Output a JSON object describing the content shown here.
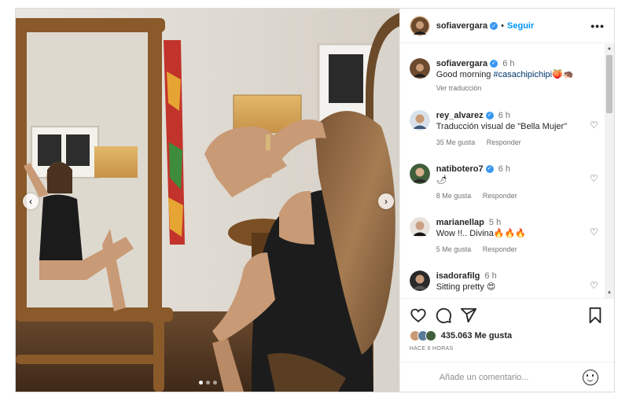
{
  "post": {
    "author": "sofiavergara",
    "separator": "•",
    "follow_label": "Seguir",
    "more_label": "•••"
  },
  "carousel": {
    "prev_label": "‹",
    "next_label": "›",
    "total_slides": 3,
    "active_slide": 1
  },
  "caption": {
    "user": "sofiavergara",
    "time": "6 h",
    "text": "Good morning ",
    "hashtag": "#casachipichipi",
    "emojis": "🍑🦔",
    "translate_label": "Ver traducción"
  },
  "comments": [
    {
      "user": "rey_alvarez",
      "time": "6 h",
      "text": "Traducción visual de \"Bella Mujer\"",
      "likes": "35 Me gusta",
      "reply": "Responder"
    },
    {
      "user": "natibotero7",
      "time": "6 h",
      "text": "🌶",
      "likes": "8 Me gusta",
      "reply": "Responder"
    },
    {
      "user": "marianellap",
      "time": "5 h",
      "text": "Wow !!.. Divina🔥🔥🔥",
      "likes": "5 Me gusta",
      "reply": "Responder"
    },
    {
      "user": "isadorafilg",
      "time": "6 h",
      "text": "Sitting pretty 😍",
      "likes": "",
      "reply": ""
    }
  ],
  "scrollbar": {
    "up": "▲",
    "down": "▼"
  },
  "likes": {
    "count": "435.063",
    "label": "Me gusta"
  },
  "post_time": "HACE 6 HORAS",
  "comment_input": {
    "placeholder": "Añade un comentario..."
  },
  "icons": {
    "verified": "✓",
    "heart": "♡"
  },
  "colors": {
    "link_blue": "#0095f6",
    "verified_blue": "#3897f0",
    "hashtag": "#00376b",
    "muted": "#737373"
  }
}
